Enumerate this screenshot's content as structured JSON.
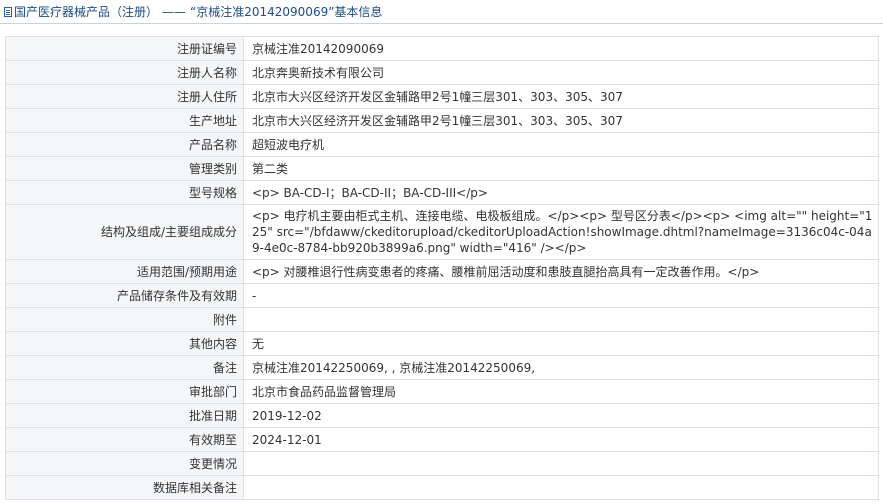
{
  "breadcrumb": {
    "icon": "document-icon",
    "category": "国产医疗器械产品（注册）",
    "separator": "——",
    "record": "“京械注准20142090069”基本信息"
  },
  "rows": [
    {
      "label": "注册证编号",
      "value": "京械注准20142090069"
    },
    {
      "label": "注册人名称",
      "value": "北京奔奥新技术有限公司"
    },
    {
      "label": "注册人住所",
      "value": "北京市大兴区经济开发区金辅路甲2号1幢三层301、303、305、307"
    },
    {
      "label": "生产地址",
      "value": "北京市大兴区经济开发区金辅路甲2号1幢三层301、303、305、307"
    },
    {
      "label": "产品名称",
      "value": "超短波电疗机"
    },
    {
      "label": "管理类别",
      "value": "第二类"
    },
    {
      "label": "型号规格",
      "value": "<p> BA-CD-I；BA-CD-II；BA-CD-III</p>"
    },
    {
      "label": "结构及组成/主要组成成分",
      "value": "<p> 电疗机主要由柜式主机、连接电缆、电极板组成。</p><p> 型号区分表</p><p> <img alt=\"\" height=\"125\" src=\"/bfdaww/ckeditorupload/ckeditorUploadAction!showImage.dhtml?nameImage=3136c04c-04a9-4e0c-8784-bb920b3899a6.png\" width=\"416\" /></p>"
    },
    {
      "label": "适用范围/预期用途",
      "value": "<p> 对腰椎退行性病变患者的疼痛、腰椎前屈活动度和患肢直腿抬高具有一定改善作用。</p>"
    },
    {
      "label": "产品储存条件及有效期",
      "value": "-"
    },
    {
      "label": "附件",
      "value": ""
    },
    {
      "label": "其他内容",
      "value": "无"
    },
    {
      "label": "备注",
      "value": "京械注准20142250069, , 京械注准20142250069,"
    },
    {
      "label": "审批部门",
      "value": "北京市食品药品监督管理局"
    },
    {
      "label": "批准日期",
      "value": "2019-12-02"
    },
    {
      "label": "有效期至",
      "value": "2024-12-01"
    },
    {
      "label": "变更情况",
      "value": ""
    },
    {
      "label": "数据库相关备注",
      "value": ""
    }
  ]
}
